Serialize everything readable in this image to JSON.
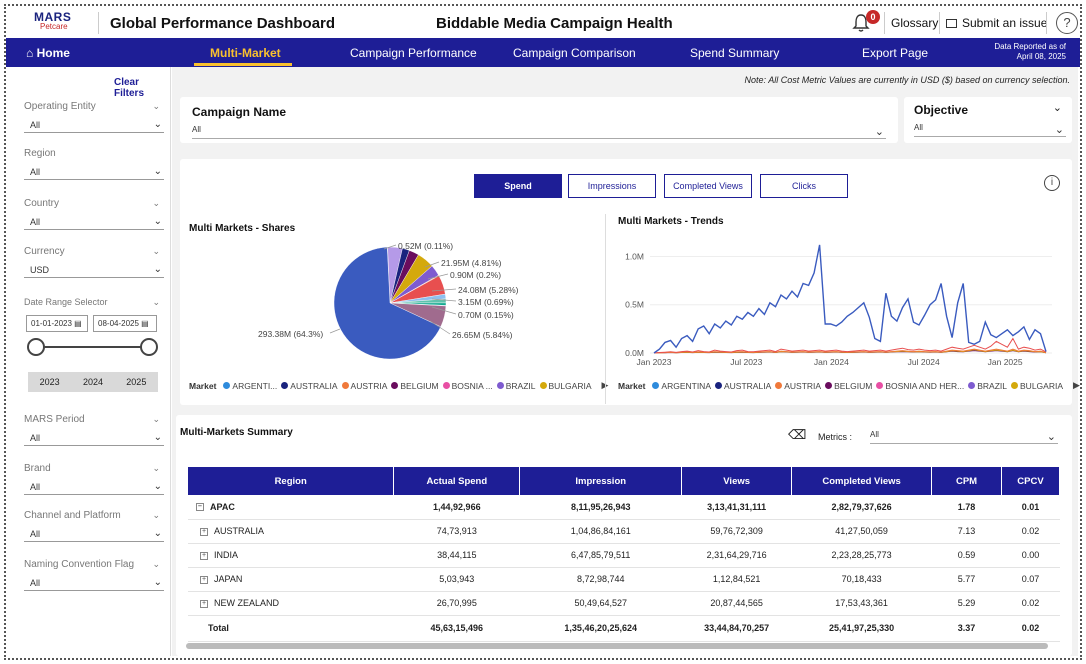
{
  "header": {
    "brand_top": "MARS",
    "brand_sub": "Petcare",
    "app_title": "Global Performance Dashboard",
    "page_title": "Biddable Media Campaign Health",
    "notif_count": "0",
    "glossary": "Glossary",
    "submit": "Submit an issue",
    "help": "?"
  },
  "nav": {
    "home": "Home",
    "tabs": [
      "Multi-Market",
      "Campaign Performance",
      "Campaign Comparison",
      "Spend Summary",
      "Export Page"
    ],
    "active_tab": "Multi-Market",
    "reported_line1": "Data Reported as of",
    "reported_line2": "April 08, 2025"
  },
  "sidebar": {
    "clear": "Clear Filters",
    "filters": [
      {
        "label": "Operating Entity",
        "value": "All"
      },
      {
        "label": "Region",
        "value": "All"
      },
      {
        "label": "Country",
        "value": "All"
      },
      {
        "label": "Currency",
        "value": "USD"
      }
    ],
    "date_label": "Date Range Selector",
    "date_from": "01-01-2023",
    "date_to": "08-04-2025",
    "years": [
      "2023",
      "2024",
      "2025"
    ],
    "filters2": [
      {
        "label": "MARS Period",
        "value": "All"
      },
      {
        "label": "Brand",
        "value": "All"
      },
      {
        "label": "Channel and Platform",
        "value": "All"
      },
      {
        "label": "Naming Convention Flag",
        "value": "All"
      }
    ]
  },
  "main": {
    "note": "Note: All Cost Metric Values are currently in USD ($) based on currency selection.",
    "campaign_label": "Campaign Name",
    "campaign_value": "All",
    "objective_label": "Objective",
    "objective_value": "All",
    "metric_buttons": [
      "Spend",
      "Impressions",
      "Completed Views",
      "Clicks"
    ],
    "active_metric": "Spend",
    "info": "i",
    "shares_title": "Multi Markets - Shares",
    "trends_title": "Multi Markets - Trends",
    "legend_title": "Market",
    "pie_legend": [
      "ARGENTI...",
      "AUSTRALIA",
      "AUSTRIA",
      "BELGIUM",
      "BOSNIA ...",
      "BRAZIL",
      "BULGARIA"
    ],
    "trend_legend": [
      "ARGENTINA",
      "AUSTRALIA",
      "AUSTRIA",
      "BELGIUM",
      "BOSNIA AND HER...",
      "BRAZIL",
      "BULGARIA"
    ],
    "legend_colors": [
      "#2e8bdc",
      "#1a237e",
      "#f0793a",
      "#6a0d5e",
      "#e84fa4",
      "#7e5bd0",
      "#d4a90c"
    ],
    "summary_title": "Multi-Markets Summary",
    "metrics_label": "Metrics :",
    "metrics_value": "All",
    "table": {
      "headers": [
        "Region",
        "Actual Spend",
        "Impression",
        "Views",
        "Completed Views",
        "CPM",
        "CPCV"
      ],
      "group": {
        "toggle": "⊟",
        "cells": [
          "APAC",
          "1,44,92,966",
          "8,11,95,26,943",
          "3,13,41,31,111",
          "2,82,79,37,626",
          "1.78",
          "0.01"
        ]
      },
      "rows": [
        {
          "toggle": "⊞",
          "cells": [
            "AUSTRALIA",
            "74,73,913",
            "1,04,86,84,161",
            "59,76,72,309",
            "41,27,50,059",
            "7.13",
            "0.02"
          ]
        },
        {
          "toggle": "⊞",
          "cells": [
            "INDIA",
            "38,44,115",
            "6,47,85,79,511",
            "2,31,64,29,716",
            "2,23,28,25,773",
            "0.59",
            "0.00"
          ]
        },
        {
          "toggle": "⊞",
          "cells": [
            "JAPAN",
            "5,03,943",
            "8,72,98,744",
            "1,12,84,521",
            "70,18,433",
            "5.77",
            "0.07"
          ]
        },
        {
          "toggle": "⊞",
          "cells": [
            "NEW ZEALAND",
            "26,70,995",
            "50,49,64,527",
            "20,87,44,565",
            "17,53,43,361",
            "5.29",
            "0.02"
          ]
        }
      ],
      "total": [
        "Total",
        "45,63,15,496",
        "1,35,46,20,25,624",
        "33,44,84,70,257",
        "25,41,97,25,330",
        "3.37",
        "0.02"
      ]
    }
  },
  "chart_data": [
    {
      "type": "pie",
      "title": "Multi Markets - Shares",
      "slices": [
        {
          "label": "293.38M (64.3%)",
          "value": 293.38,
          "color": "#3a5bbf"
        },
        {
          "label": "26.65M (5.84%)",
          "value": 26.65,
          "color": "#a06b8e"
        },
        {
          "label": "0.70M (0.15%)",
          "value": 0.7,
          "color": "#2e8bdc"
        },
        {
          "label": "3.15M (0.69%)",
          "value": 3.15,
          "color": "#12a98f"
        },
        {
          "label": "24.08M (5.28%)",
          "value": 24.08,
          "color": "#e84f4f"
        },
        {
          "label": "0.90M (0.2%)",
          "value": 0.9,
          "color": "#f0793a"
        },
        {
          "label": "21.95M (4.81%)",
          "value": 21.95,
          "color": "#d4a90c"
        },
        {
          "label": "0.52M (0.11%)",
          "value": 0.52,
          "color": "#e84fa4"
        }
      ],
      "unlabeled_remainder": [
        {
          "value": 18.5,
          "color": "#b59ae8"
        },
        {
          "value": 14.0,
          "color": "#7e5bd0"
        },
        {
          "value": 12.5,
          "color": "#6a0d5e"
        },
        {
          "value": 9.0,
          "color": "#1a237e"
        },
        {
          "value": 6.0,
          "color": "#8fc0ee"
        },
        {
          "value": 5.0,
          "color": "#5fc3ad"
        }
      ]
    },
    {
      "type": "line",
      "title": "Multi Markets - Trends",
      "y_ticks": [
        "1.0M",
        "0.5M",
        "0.0M"
      ],
      "x_ticks": [
        "Jan 2023",
        "Jul 2023",
        "Jan 2024",
        "Jul 2024",
        "Jan 2025"
      ],
      "ylim": [
        0,
        1150000
      ],
      "series": [
        {
          "color": "#3a5bbf",
          "values": [
            0,
            40000,
            110000,
            130000,
            60000,
            150000,
            180000,
            120000,
            250000,
            280000,
            200000,
            300000,
            260000,
            330000,
            290000,
            380000,
            350000,
            420000,
            380000,
            460000,
            400000,
            520000,
            480000,
            600000,
            560000,
            640000,
            580000,
            720000,
            700000,
            830000,
            1120000,
            300000,
            300000,
            280000,
            320000,
            380000,
            420000,
            470000,
            520000,
            370000,
            150000,
            120000,
            620000,
            380000,
            330000,
            470000,
            560000,
            320000,
            290000,
            390000,
            500000,
            550000,
            720000,
            380000,
            160000,
            520000,
            720000,
            110000,
            90000,
            120000,
            320000,
            190000,
            160000,
            200000,
            240000,
            180000,
            220000,
            270000,
            140000,
            240000,
            200000,
            15000
          ]
        },
        {
          "color": "#e84f4f",
          "values": [
            0,
            5000,
            8000,
            12000,
            6000,
            15000,
            20000,
            10000,
            25000,
            15000,
            10000,
            30000,
            20000,
            15000,
            10000,
            25000,
            30000,
            15000,
            12000,
            20000,
            25000,
            30000,
            15000,
            40000,
            30000,
            20000,
            25000,
            30000,
            20000,
            25000,
            30000,
            20000,
            25000,
            30000,
            20000,
            15000,
            20000,
            25000,
            30000,
            20000,
            25000,
            30000,
            20000,
            30000,
            40000,
            50000,
            35000,
            30000,
            40000,
            30000,
            25000,
            30000,
            20000,
            40000,
            60000,
            50000,
            40000,
            60000,
            80000,
            60000,
            40000,
            70000,
            120000,
            90000,
            60000,
            150000,
            40000,
            60000,
            50000,
            30000,
            40000,
            10000
          ]
        },
        {
          "color": "#f0793a",
          "values": [
            0,
            3000,
            5000,
            8000,
            4000,
            8000,
            12000,
            6000,
            10000,
            8000,
            6000,
            15000,
            10000,
            8000,
            6000,
            12000,
            15000,
            8000,
            6000,
            10000,
            12000,
            15000,
            8000,
            20000,
            15000,
            10000,
            12000,
            15000,
            10000,
            12000,
            15000,
            10000,
            12000,
            15000,
            10000,
            8000,
            10000,
            12000,
            15000,
            10000,
            12000,
            15000,
            10000,
            15000,
            20000,
            25000,
            18000,
            15000,
            20000,
            15000,
            12000,
            15000,
            10000,
            20000,
            30000,
            25000,
            20000,
            30000,
            40000,
            30000,
            20000,
            30000,
            40000,
            30000,
            20000,
            40000,
            20000,
            30000,
            25000,
            15000,
            20000,
            5000
          ]
        },
        {
          "color": "#d4a90c",
          "values": [
            0,
            2000,
            4000,
            6000,
            3000,
            6000,
            8000,
            5000,
            8000,
            6000,
            5000,
            10000,
            8000,
            6000,
            5000,
            8000,
            10000,
            6000,
            5000,
            8000,
            10000,
            12000,
            6000,
            15000,
            12000,
            8000,
            10000,
            12000,
            8000,
            10000,
            12000,
            8000,
            10000,
            12000,
            8000,
            6000,
            8000,
            10000,
            12000,
            8000,
            10000,
            12000,
            8000,
            12000,
            15000,
            20000,
            15000,
            12000,
            15000,
            12000,
            10000,
            12000,
            8000,
            15000,
            25000,
            20000,
            15000,
            25000,
            35000,
            25000,
            15000,
            25000,
            30000,
            25000,
            15000,
            30000,
            15000,
            25000,
            20000,
            12000,
            15000,
            3000
          ]
        },
        {
          "color": "#6a0d5e",
          "values": [
            0,
            2000,
            3000,
            5000,
            3000,
            5000,
            6000,
            4000,
            6000,
            5000,
            4000,
            8000,
            6000,
            5000,
            4000,
            6000,
            8000,
            5000,
            4000,
            6000,
            8000,
            10000,
            5000,
            12000,
            10000,
            6000,
            8000,
            10000,
            6000,
            8000,
            10000,
            6000,
            8000,
            10000,
            6000,
            5000,
            6000,
            8000,
            10000,
            6000,
            8000,
            10000,
            6000,
            10000,
            12000,
            15000,
            12000,
            10000,
            12000,
            10000,
            8000,
            10000,
            6000,
            12000,
            20000,
            15000,
            12000,
            20000,
            25000,
            20000,
            12000,
            20000,
            25000,
            20000,
            12000,
            25000,
            12000,
            20000,
            15000,
            10000,
            12000,
            2000
          ]
        }
      ]
    }
  ]
}
